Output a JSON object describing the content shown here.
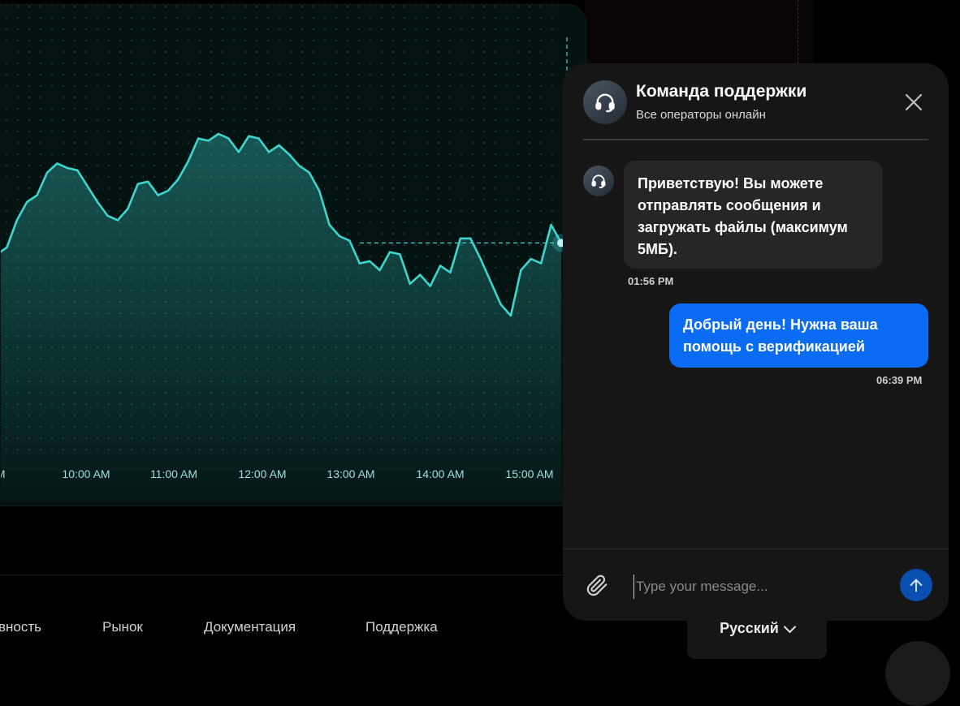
{
  "chart_data": {
    "type": "line",
    "x_ticks": [
      "AM",
      "10:00 AM",
      "11:00 AM",
      "12:00 AM",
      "13:00 AM",
      "14:00 AM",
      "15:00 AM"
    ],
    "y_relative": [
      0.42,
      0.45,
      0.57,
      0.65,
      0.68,
      0.78,
      0.82,
      0.8,
      0.79,
      0.72,
      0.65,
      0.59,
      0.57,
      0.62,
      0.73,
      0.74,
      0.68,
      0.7,
      0.75,
      0.83,
      0.93,
      0.92,
      0.95,
      0.93,
      0.87,
      0.94,
      0.93,
      0.87,
      0.9,
      0.86,
      0.81,
      0.78,
      0.7,
      0.55,
      0.5,
      0.48,
      0.38,
      0.39,
      0.35,
      0.43,
      0.42,
      0.29,
      0.33,
      0.28,
      0.37,
      0.34,
      0.49,
      0.49,
      0.4,
      0.3,
      0.2,
      0.15,
      0.35,
      0.4,
      0.38,
      0.55,
      0.47
    ],
    "line_color": "#3dd6cf",
    "current_marker_color": "#b9f3f0",
    "grid": "dotted"
  },
  "footer_nav": [
    "вность",
    "Рынок",
    "Документация",
    "Поддержка"
  ],
  "language": "Русский",
  "chat": {
    "title": "Команда поддержки",
    "subtitle": "Все операторы онлайн",
    "messages": [
      {
        "sender": "support",
        "text": "Приветствую! Вы можете отправлять сообщения и загружать файлы (максимум 5МБ).",
        "time": "01:56 PM"
      },
      {
        "sender": "user",
        "text": "Добрый день! Нужна ваша помощь с верификацией",
        "time": "06:39 PM"
      }
    ],
    "input_placeholder": "Type your message...",
    "icons": {
      "avatar": "headset-icon",
      "close": "close-icon",
      "attach": "paperclip-icon",
      "send": "arrow-up-icon"
    },
    "colors": {
      "user_bubble": "#0a6cf5",
      "support_bubble": "#262626",
      "panel": "#161616",
      "send_button": "#0a4fb0"
    }
  }
}
